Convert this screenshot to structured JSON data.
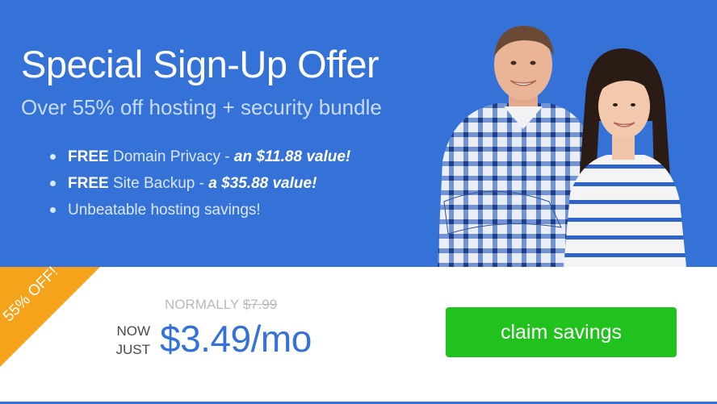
{
  "hero": {
    "title": "Special Sign-Up Offer",
    "subtitle": "Over 55% off hosting + security bundle",
    "bullets": [
      {
        "strong": "FREE",
        "text": " Domain Privacy - ",
        "value": "an $11.88 value!"
      },
      {
        "strong": "FREE",
        "text": " Site Backup - ",
        "value": "a $35.88 value!"
      },
      {
        "strong": "",
        "text": "Unbeatable hosting savings!",
        "value": ""
      }
    ],
    "image_icon": "smiling-couple-photo"
  },
  "offer": {
    "ribbon": "55% OFF!",
    "normally_label": "NORMALLY",
    "normally_price": "$7.99",
    "now_label": "NOW",
    "just_label": "JUST",
    "price": "$3.49/mo",
    "cta_label": "claim savings"
  },
  "colors": {
    "brand_blue": "#3472d8",
    "ribbon_orange": "#f5a31a",
    "cta_green": "#21c11e"
  }
}
